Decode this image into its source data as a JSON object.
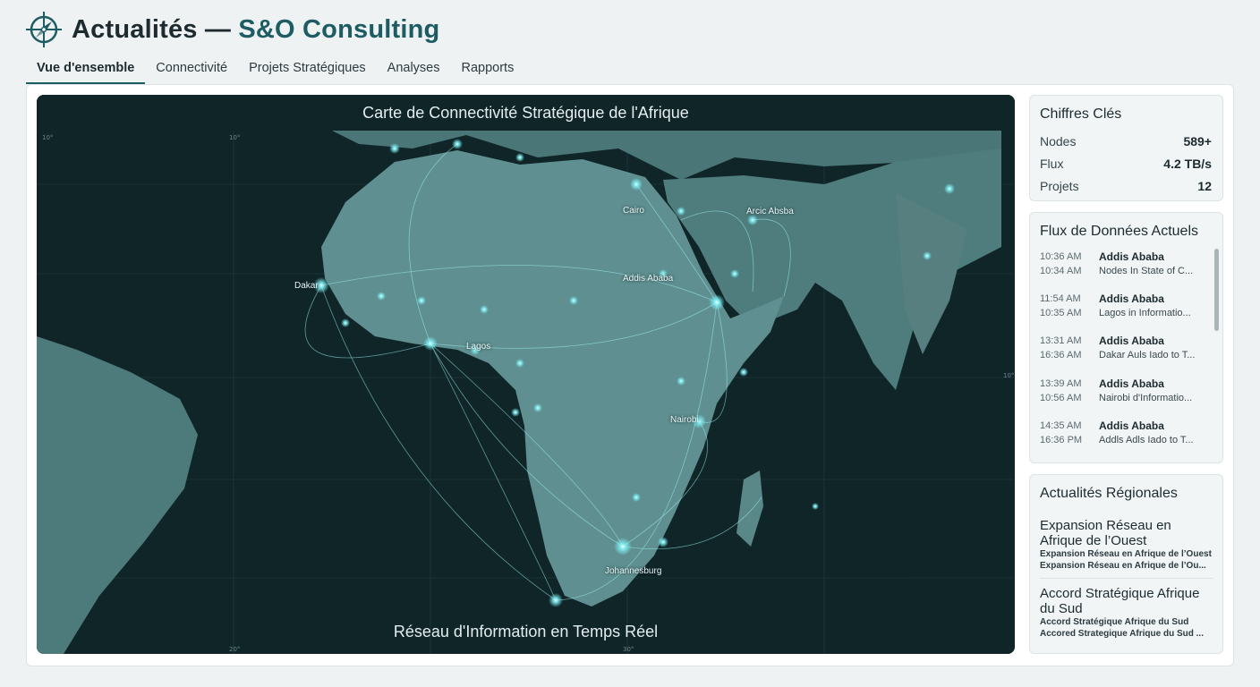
{
  "header": {
    "title_main": "Actualités — ",
    "title_brand": "S&O Consulting",
    "logo_icon": "compass-icon"
  },
  "tabs": [
    {
      "label": "Vue d'ensemble",
      "active": true
    },
    {
      "label": "Connectivité",
      "active": false
    },
    {
      "label": "Projets Stratégiques",
      "active": false
    },
    {
      "label": "Analyses",
      "active": false
    },
    {
      "label": "Rapports",
      "active": false
    }
  ],
  "map": {
    "title": "Carte de Connectivité Stratégique de l'Afrique",
    "subtitle": "Réseau d'Information en Temps Réel",
    "labels": [
      "Cairo",
      "Arcic Absba",
      "Dakar",
      "Addis Ababa",
      "Lagos",
      "Nairobi",
      "Johannesburg"
    ],
    "colors": {
      "land": "#4f7d7e",
      "ocean": "#102528",
      "glow": "#7ff3f7"
    }
  },
  "stats": {
    "title": "Chiffres Clés",
    "rows": [
      {
        "label": "Nodes",
        "value": "589+"
      },
      {
        "label": "Flux",
        "value": "4.2 TB/s"
      },
      {
        "label": "Projets",
        "value": "12"
      }
    ]
  },
  "flux": {
    "title": "Flux de Données Actuels",
    "items": [
      {
        "t1": "10:36 AM",
        "t2": "10:34 AM",
        "city": "Addis Ababa",
        "desc": "Nodes In State of C..."
      },
      {
        "t1": "11:54 AM",
        "t2": "10:35 AM",
        "city": "Addis Ababa",
        "desc": "Lagos in Informatio..."
      },
      {
        "t1": "13:31 AM",
        "t2": "16:36 AM",
        "city": "Addis Ababa",
        "desc": "Dakar Auls Iado to T..."
      },
      {
        "t1": "13:39 AM",
        "t2": "10:56 AM",
        "city": "Addis Ababa",
        "desc": "Nairobi d'Informatio..."
      },
      {
        "t1": "14:35 AM",
        "t2": "16:36 PM",
        "city": "Addis Ababa",
        "desc": "Addls Adls Iado to T..."
      }
    ]
  },
  "news": {
    "title": "Actualités Régionales",
    "items": [
      {
        "headline": "Expansion Réseau en Afrique de l’Ouest",
        "line1": "Expansion Réseau en Afrique de l’Ouest",
        "line2": "Expansion Réseau en Afrique de l’Ou..."
      },
      {
        "headline": "Accord Stratégique Afrique du Sud",
        "line1": "Accord Stratégique Afrique du Sud",
        "line2": "Accored Strategique Afrique du Sud ..."
      }
    ]
  }
}
